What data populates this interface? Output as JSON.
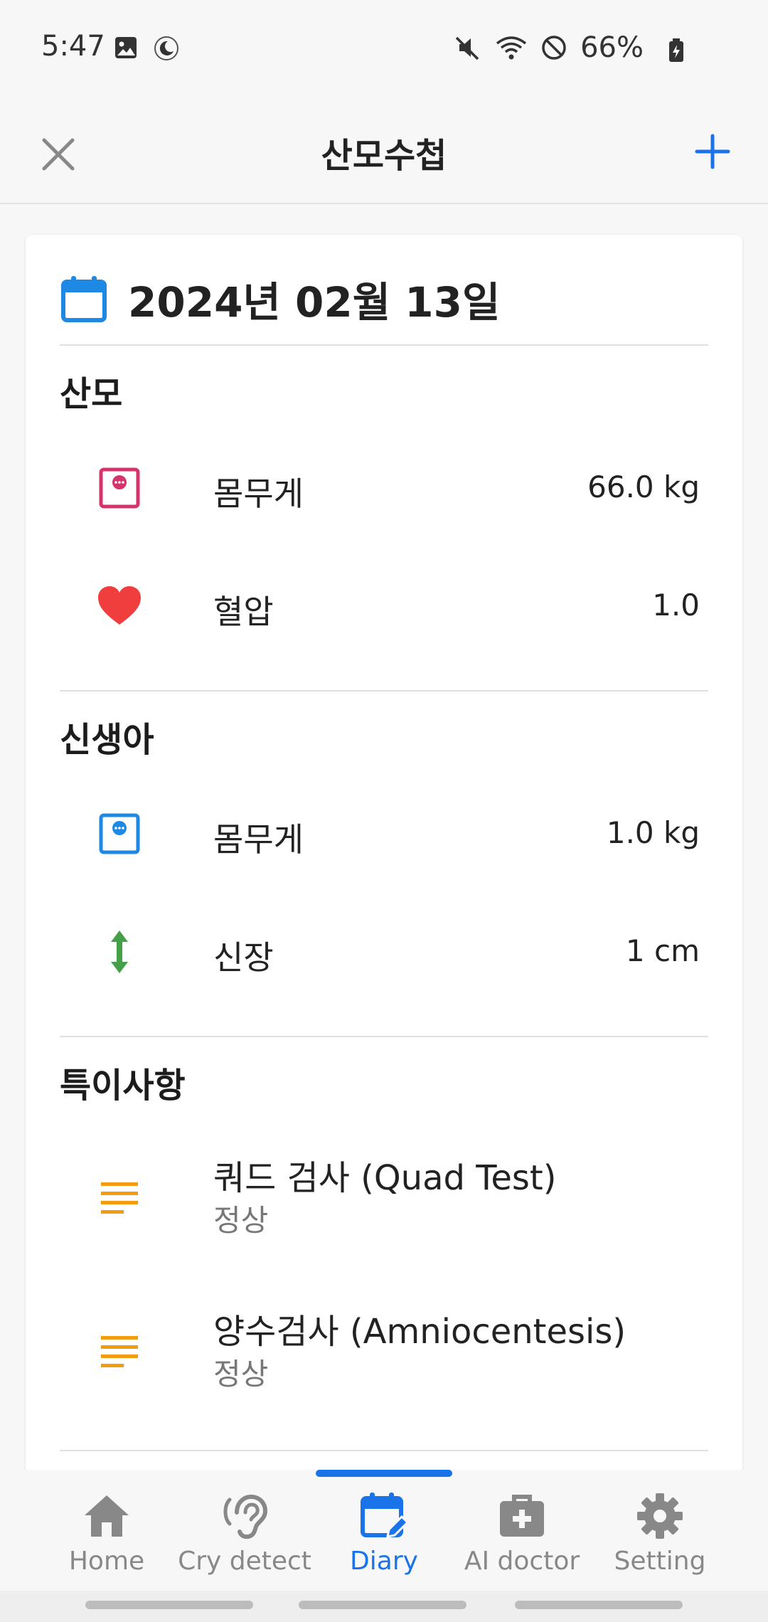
{
  "status_bar": {
    "time": "5:47",
    "battery": "66%"
  },
  "app_bar": {
    "title": "산모수첩",
    "close_icon": "close-icon",
    "add_icon": "plus-icon"
  },
  "colors": {
    "accent": "#1a73e8",
    "weight_mother": "#d6336c",
    "heart": "#f03e3e",
    "weight_baby": "#1e88e5",
    "height": "#43a047",
    "notes": "#f39c12"
  },
  "diary": {
    "date": "2024년 02월 13일",
    "mother": {
      "title": "산모",
      "items": [
        {
          "label": "몸무게",
          "value": "66.0 kg",
          "icon": "scale-icon"
        },
        {
          "label": "혈압",
          "value": "1.0",
          "icon": "heart-icon"
        }
      ]
    },
    "newborn": {
      "title": "신생아",
      "items": [
        {
          "label": "몸무게",
          "value": "1.0 kg",
          "icon": "scale-icon"
        },
        {
          "label": "신장",
          "value": "1 cm",
          "icon": "height-arrow-icon"
        }
      ]
    },
    "notes": {
      "title": "특이사항",
      "items": [
        {
          "title": "쿼드 검사 (Quad Test)",
          "result": "정상",
          "icon": "notes-lines-icon"
        },
        {
          "title": "양수검사 (Amniocentesis)",
          "result": "정상",
          "icon": "notes-lines-icon"
        }
      ]
    }
  },
  "bottom_nav": {
    "items": [
      {
        "label": "Home",
        "icon": "home-icon"
      },
      {
        "label": "Cry detect",
        "icon": "ear-icon"
      },
      {
        "label": "Diary",
        "icon": "calendar-edit-icon",
        "active": true
      },
      {
        "label": "AI doctor",
        "icon": "medical-kit-icon"
      },
      {
        "label": "Setting",
        "icon": "gear-icon"
      }
    ]
  }
}
